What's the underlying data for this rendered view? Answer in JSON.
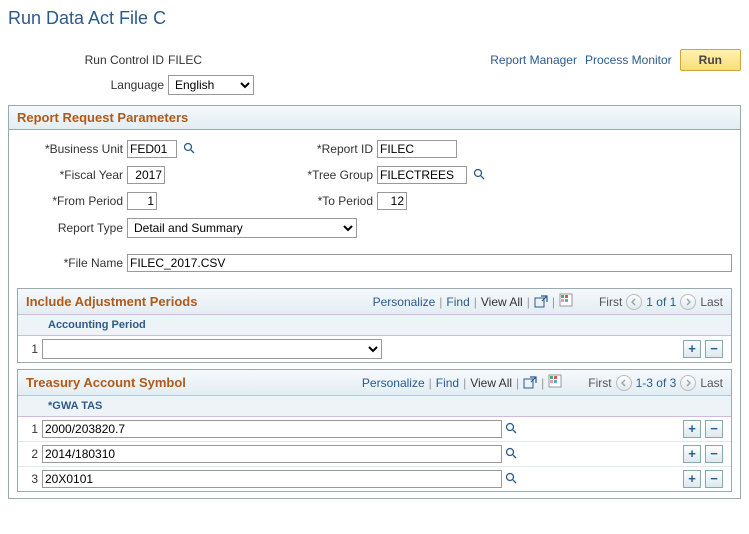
{
  "page": {
    "title": "Run Data Act File C"
  },
  "header": {
    "run_control_id_label": "Run Control ID",
    "run_control_id_value": "FILEC",
    "language_label": "Language",
    "language_value": "English",
    "report_manager": "Report Manager",
    "process_monitor": "Process Monitor",
    "run_button": "Run"
  },
  "params": {
    "group_title": "Report Request Parameters",
    "business_unit_label": "*Business Unit",
    "business_unit_value": "FED01",
    "report_id_label": "*Report ID",
    "report_id_value": "FILEC",
    "fiscal_year_label": "*Fiscal Year",
    "fiscal_year_value": "2017",
    "tree_group_label": "*Tree Group",
    "tree_group_value": "FILECTREES",
    "from_period_label": "*From Period",
    "from_period_value": "1",
    "to_period_label": "*To Period",
    "to_period_value": "12",
    "report_type_label": "Report Type",
    "report_type_value": "Detail and Summary",
    "file_name_label": "*File Name",
    "file_name_value": "FILEC_2017.CSV"
  },
  "grid_tools": {
    "personalize": "Personalize",
    "find": "Find",
    "view_all": "View All",
    "first": "First",
    "last": "Last"
  },
  "adjustment": {
    "title": "Include Adjustment Periods",
    "column_header": "Accounting Period",
    "nav_counter": "1 of 1",
    "rows": [
      {
        "num": "1",
        "value": ""
      }
    ]
  },
  "tas": {
    "title": "Treasury Account Symbol",
    "column_header": "*GWA TAS",
    "nav_counter": "1-3 of 3",
    "rows": [
      {
        "num": "1",
        "value": "2000/203820.7"
      },
      {
        "num": "2",
        "value": "2014/180310"
      },
      {
        "num": "3",
        "value": "20X0101"
      }
    ]
  }
}
